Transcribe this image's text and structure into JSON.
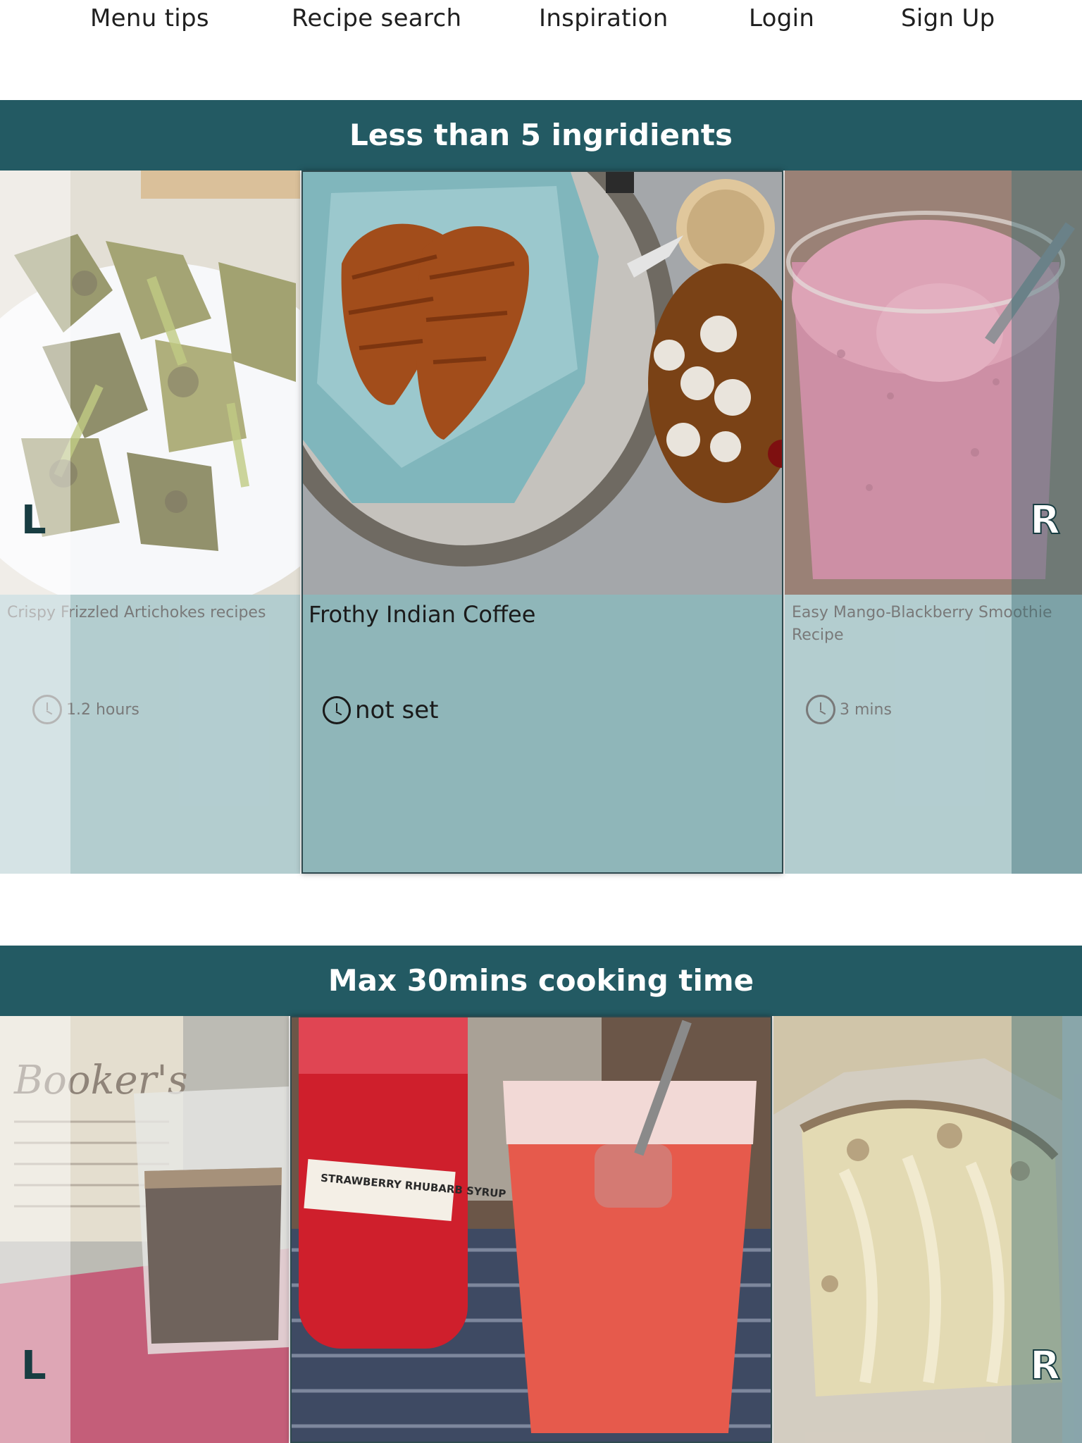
{
  "nav": {
    "items": [
      "Menu tips",
      "Recipe search",
      "Inspiration",
      "Login",
      "Sign Up"
    ]
  },
  "sections": [
    {
      "title": "Less than 5 ingridients",
      "cards": [
        {
          "title": "Crispy Frizzled Artichokes recipes",
          "time": "1.2 hours",
          "image": "fried-artichokes-photo"
        },
        {
          "title": "Frothy Indian Coffee",
          "time": "not set",
          "image": "croissants-coffee-photo"
        },
        {
          "title": "Easy Mango-Blackberry Smoothie Recipe",
          "time": "3 mins",
          "image": "berry-smoothie-photo"
        }
      ]
    },
    {
      "title": "Max 30mins cooking time",
      "cards": [
        {
          "title": "",
          "time": "",
          "image": "bourbon-glass-photo"
        },
        {
          "title": "",
          "time": "",
          "image": "strawberry-rhubarb-soda-photo"
        },
        {
          "title": "",
          "time": "",
          "image": "roasted-cabbage-photo"
        }
      ]
    }
  ],
  "photo_labels": {
    "syrup_bottle": "STRAWBERRY RHUBARB SYRUP",
    "bourbon_label": "Booker's"
  },
  "carousel": {
    "prev_label": "L",
    "next_label": "R"
  },
  "colors": {
    "band": "#235a63",
    "card_body": "#8fb6b9",
    "arrow": "#183d42"
  }
}
